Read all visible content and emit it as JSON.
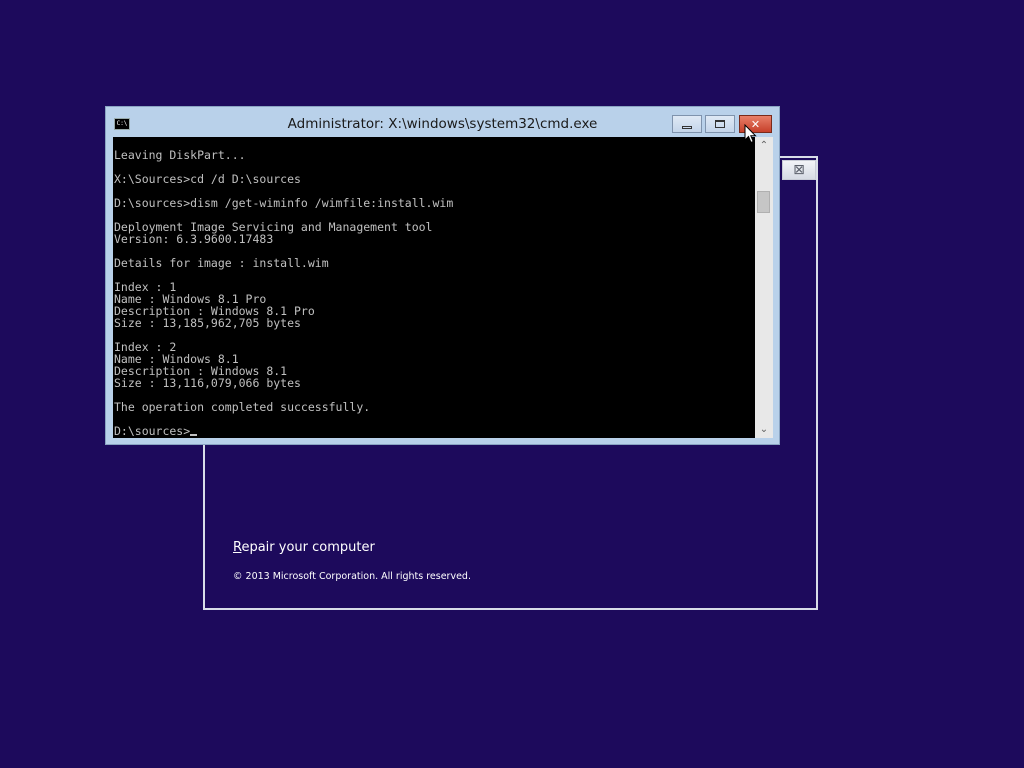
{
  "cmd": {
    "icon_text": "C:\\",
    "title": "Administrator: X:\\windows\\system32\\cmd.exe",
    "console_text": "Leaving DiskPart...\n\nX:\\Sources>cd /d D:\\sources\n\nD:\\sources>dism /get-wiminfo /wimfile:install.wim\n\nDeployment Image Servicing and Management tool\nVersion: 6.3.9600.17483\n\nDetails for image : install.wim\n\nIndex : 1\nName : Windows 8.1 Pro\nDescription : Windows 8.1 Pro\nSize : 13,185,962,705 bytes\n\nIndex : 2\nName : Windows 8.1\nDescription : Windows 8.1\nSize : 13,116,079,066 bytes\n\nThe operation completed successfully.\n\n",
    "prompt": "D:\\sources>",
    "close_glyph": "✕",
    "scroll_up_glyph": "⌃",
    "scroll_down_glyph": "⌄"
  },
  "setup": {
    "close_glyph": "⊠",
    "repair_first_letter": "R",
    "repair_rest": "epair your computer",
    "copyright": "© 2013 Microsoft Corporation. All rights reserved."
  },
  "colors": {
    "desktop_bg": "#1d0a5c",
    "console_bg": "#000000",
    "console_fg": "#c0c0c0",
    "close_button": "#c7402a"
  },
  "icons": [
    "cmd-app-icon",
    "minimize-icon",
    "maximize-icon",
    "close-icon",
    "scroll-up-icon",
    "scroll-down-icon",
    "mouse-pointer-icon"
  ]
}
